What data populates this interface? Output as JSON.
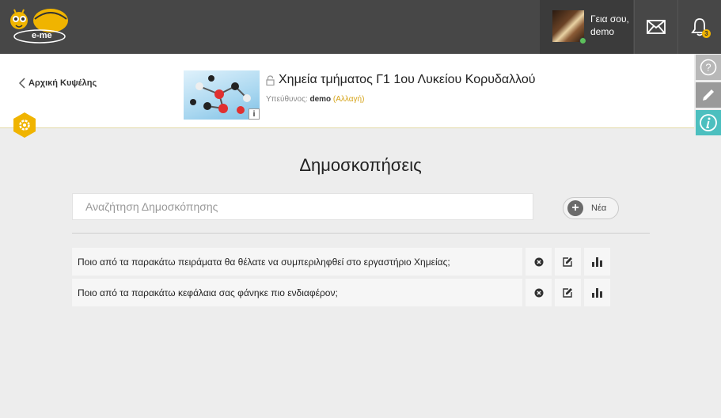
{
  "topbar": {
    "logo_text": "e-me",
    "greeting_line1": "Γεια σου,",
    "greeting_line2": "demo",
    "notification_count": "3"
  },
  "header": {
    "back_label": "Αρχική Κυψέλης",
    "course_title": "Χημεία τμήματος Γ1 1ου Λυκείου Κορυδαλλού",
    "owner_label": "Υπεύθυνος:",
    "owner_name": "demo",
    "change_label": "(Αλλαγή)",
    "info_label": "i"
  },
  "side_tools": {
    "help": "?"
  },
  "main": {
    "title": "Δημοσκοπήσεις",
    "search_placeholder": "Αναζήτηση Δημοσκόπησης",
    "new_button_label": "Νέα",
    "polls": [
      {
        "question": "Ποιο από τα παρακάτω πειράματα θα θέλατε να συμπεριληφθεί στο εργαστήριο Χημείας;"
      },
      {
        "question": "Ποιο από τα παρακάτω κεφάλαια σας φάνηκε πιο ενδιαφέρον;"
      }
    ]
  },
  "colors": {
    "topbar": "#474747",
    "accent_yellow": "#f0b400",
    "info_teal": "#4cbfbf"
  },
  "icons": [
    "e-me-logo",
    "mail-icon",
    "bell-icon",
    "chevron-left-icon",
    "lock-icon",
    "gear-icon",
    "help-icon",
    "pencil-icon",
    "info-icon",
    "plus-icon",
    "close-circle-icon",
    "edit-icon",
    "bar-chart-icon"
  ]
}
